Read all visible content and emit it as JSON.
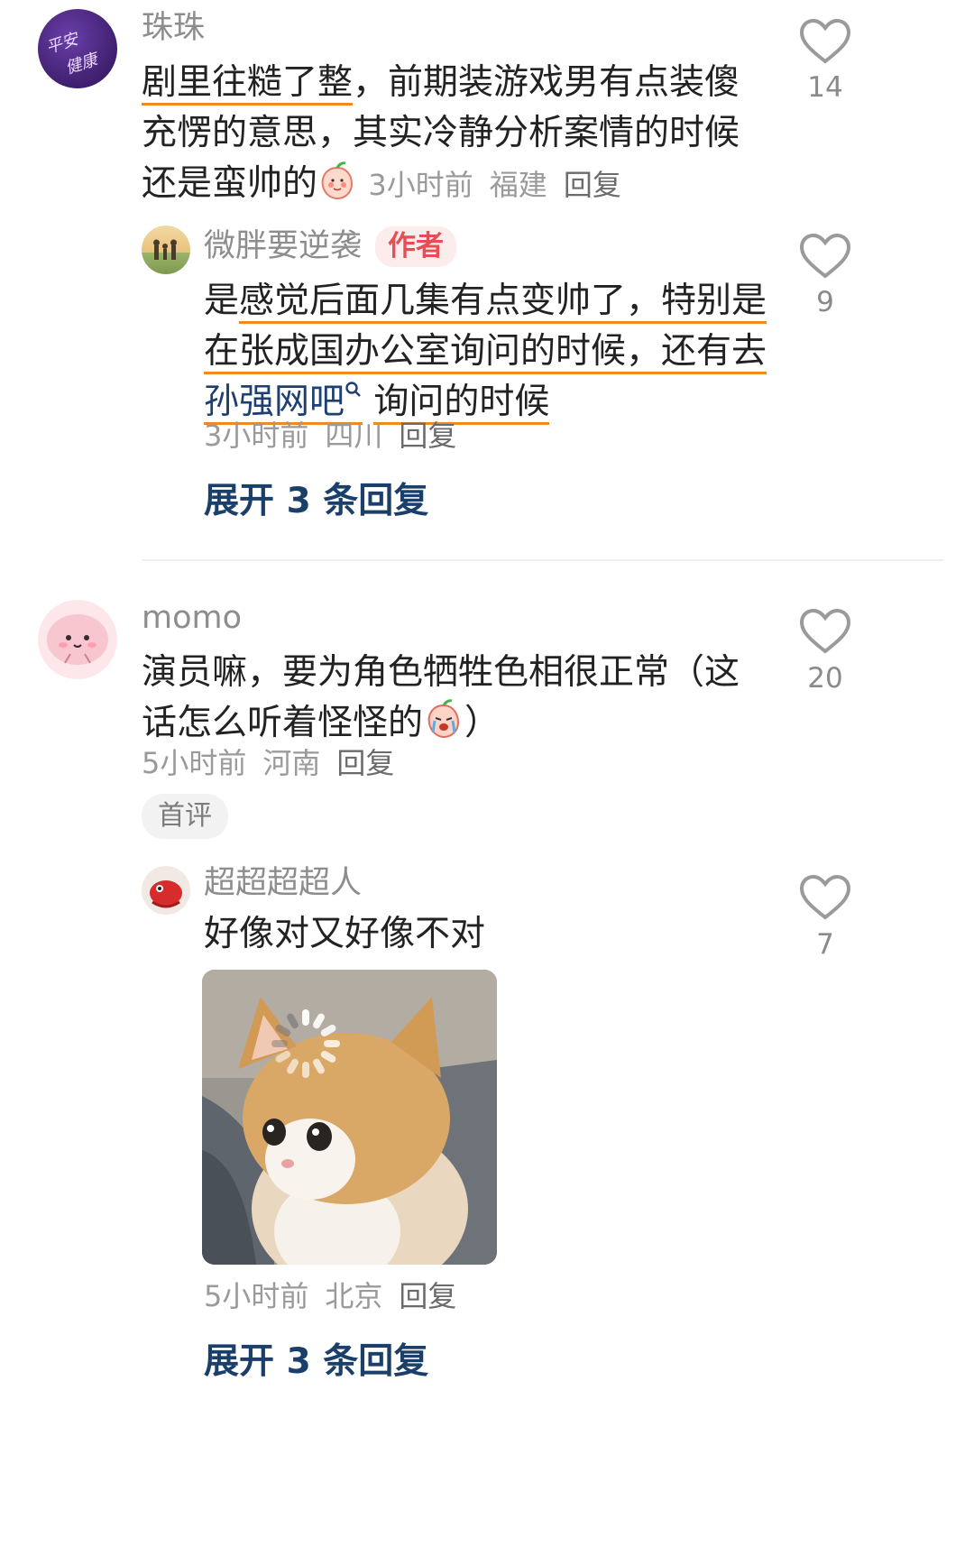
{
  "comments": [
    {
      "user": "珠珠",
      "avatar_text": [
        "平安",
        "健康"
      ],
      "avatar_icon": "purple-calligraphy-avatar",
      "text_lines": [
        "剧里往糙了整，前期装游戏男有点装傻",
        "充愣的意思，其实冷静分析案情的时候",
        "还是蛮帅的"
      ],
      "underlined": "剧里往糙了整",
      "emoji": "peach-blush-emoji",
      "time": "3小时前",
      "location": "福建",
      "reply_label": "回复",
      "likes": "14",
      "reply": {
        "user": "微胖要逆袭",
        "author_tag": "作者",
        "avatar_icon": "family-photo-avatar",
        "line1_prefix": "是",
        "line1_underlined": "感觉后面几集有点变帅了，特别是",
        "line2": "在张成国办公室询问的时候，还有去",
        "line3_link": "孙强网吧",
        "line3_rest": "询问的时候",
        "search_icon": "search-mini-icon",
        "time": "3小时前",
        "location": "四川",
        "reply_label": "回复",
        "likes": "9"
      },
      "expand_label": "展开 3 条回复"
    },
    {
      "user": "momo",
      "avatar_icon": "pink-blob-avatar",
      "text_lines": [
        "演员嘛，要为角色牺牲色相很正常（这",
        "话怎么听着怪怪的",
        "）"
      ],
      "emoji": "peach-crying-emoji",
      "time": "5小时前",
      "location": "河南",
      "reply_label": "回复",
      "badge": "首评",
      "likes": "20",
      "reply": {
        "user": "超超超超人",
        "avatar_icon": "red-toy-avatar",
        "text": "好像对又好像不对",
        "image": "loading-cat-meme",
        "time": "5小时前",
        "location": "北京",
        "reply_label": "回复",
        "likes": "7"
      },
      "expand_label": "展开 3 条回复"
    }
  ],
  "colors": {
    "accent_underline": "#f08a1f",
    "author_tag_bg": "#fdecec",
    "author_tag_text": "#e84c55",
    "expand_text": "#1a3f6b",
    "link": "#1e3f72"
  },
  "like_icon": "heart-outline-icon"
}
